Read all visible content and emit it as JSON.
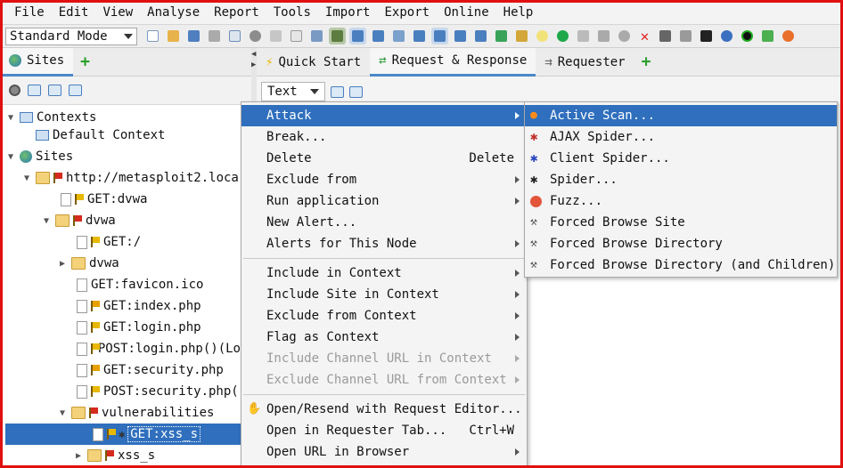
{
  "menubar": [
    "File",
    "Edit",
    "View",
    "Analyse",
    "Report",
    "Tools",
    "Import",
    "Export",
    "Online",
    "Help"
  ],
  "toolbar": {
    "mode": "Standard Mode"
  },
  "left_tabs": {
    "sites": "Sites"
  },
  "right_tabs": {
    "quick_start": "Quick Start",
    "request_response": "Request & Response",
    "requester": "Requester"
  },
  "view_select": "Text",
  "tree": [
    {
      "label": "Contexts",
      "toggle": "▼",
      "icon": "contexts-icon"
    },
    {
      "label": "Default Context",
      "toggle": "",
      "icon": "context-icon"
    },
    {
      "label": "Sites",
      "toggle": "▼",
      "icon": "globe-icon"
    },
    {
      "label": "http://metasploit2.loca",
      "toggle": "▼",
      "icon": "folder-icon"
    },
    {
      "label": "GET:dvwa",
      "toggle": "",
      "icon": "page-icon"
    },
    {
      "label": "dvwa",
      "toggle": "▼",
      "icon": "folder-icon"
    },
    {
      "label": "GET:/",
      "toggle": "",
      "icon": "page-icon"
    },
    {
      "label": "dvwa",
      "toggle": "▶",
      "icon": "folder-icon"
    },
    {
      "label": "GET:favicon.ico",
      "toggle": "",
      "icon": "page-icon"
    },
    {
      "label": "GET:index.php",
      "toggle": "",
      "icon": "page-icon"
    },
    {
      "label": "GET:login.php",
      "toggle": "",
      "icon": "page-icon"
    },
    {
      "label": "POST:login.php()(Lo",
      "toggle": "",
      "icon": "page-icon"
    },
    {
      "label": "GET:security.php",
      "toggle": "",
      "icon": "page-icon"
    },
    {
      "label": "POST:security.php(",
      "toggle": "",
      "icon": "page-icon"
    },
    {
      "label": "vulnerabilities",
      "toggle": "▼",
      "icon": "folder-icon"
    },
    {
      "label": "GET:xss_s",
      "toggle": "",
      "icon": "page-icon"
    },
    {
      "label": "xss_s",
      "toggle": "▶",
      "icon": "folder-icon"
    }
  ],
  "context_menu": [
    {
      "label": "Attack",
      "shortcut": "",
      "submenu": true,
      "disabled": false,
      "highlight": true
    },
    {
      "label": "Break...",
      "shortcut": "",
      "submenu": false,
      "disabled": false
    },
    {
      "label": "Delete",
      "shortcut": "Delete",
      "submenu": false,
      "disabled": false
    },
    {
      "label": "Exclude from",
      "shortcut": "",
      "submenu": true,
      "disabled": false
    },
    {
      "label": "Run application",
      "shortcut": "",
      "submenu": true,
      "disabled": false
    },
    {
      "label": "New Alert...",
      "shortcut": "",
      "submenu": false,
      "disabled": false
    },
    {
      "label": "Alerts for This Node",
      "shortcut": "",
      "submenu": true,
      "disabled": false
    },
    {
      "label": "Include in Context",
      "shortcut": "",
      "submenu": true,
      "disabled": false
    },
    {
      "label": "Include Site in Context",
      "shortcut": "",
      "submenu": true,
      "disabled": false
    },
    {
      "label": "Exclude from Context",
      "shortcut": "",
      "submenu": true,
      "disabled": false
    },
    {
      "label": "Flag as Context",
      "shortcut": "",
      "submenu": true,
      "disabled": false
    },
    {
      "label": "Include Channel URL in Context",
      "shortcut": "",
      "submenu": true,
      "disabled": true
    },
    {
      "label": "Exclude Channel URL from Context",
      "shortcut": "",
      "submenu": true,
      "disabled": true
    },
    {
      "label": "Open/Resend with Request Editor...",
      "shortcut": "",
      "submenu": false,
      "disabled": false
    },
    {
      "label": "Open in Requester Tab...",
      "shortcut": "Ctrl+W",
      "submenu": false,
      "disabled": false
    },
    {
      "label": "Open URL in Browser",
      "shortcut": "",
      "submenu": true,
      "disabled": false
    }
  ],
  "attack_submenu": [
    {
      "label": "Active Scan...",
      "icon": "flame-icon"
    },
    {
      "label": "AJAX Spider...",
      "icon": "spider-icon"
    },
    {
      "label": "Client Spider...",
      "icon": "spider-icon"
    },
    {
      "label": "Spider...",
      "icon": "spider-icon"
    },
    {
      "label": "Fuzz...",
      "icon": "fuzz-icon"
    },
    {
      "label": "Forced Browse Site",
      "icon": "hammer-icon"
    },
    {
      "label": "Forced Browse Directory",
      "icon": "hammer-icon"
    },
    {
      "label": "Forced Browse Directory (and Children)",
      "icon": "hammer-icon"
    }
  ],
  "colors": {
    "highlight": "#2f6fbd",
    "frame": "#e01010"
  }
}
